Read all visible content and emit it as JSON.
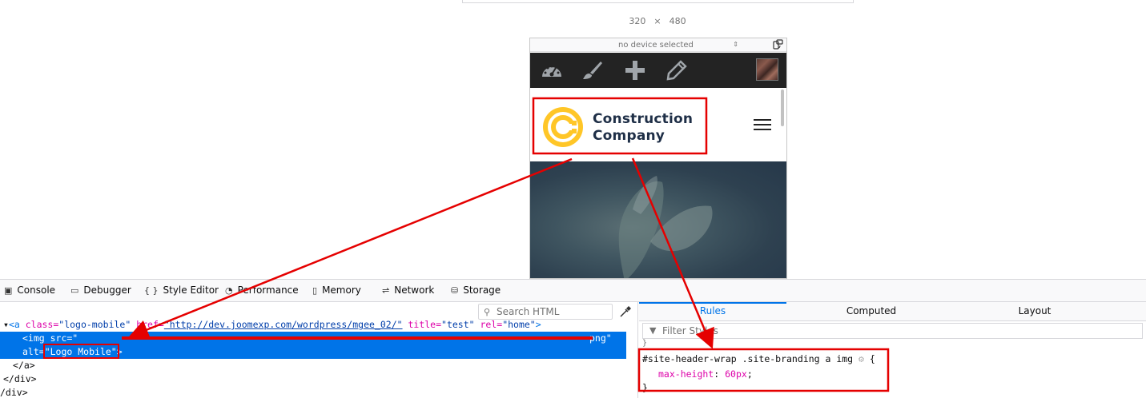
{
  "device": {
    "width": "320",
    "times": "×",
    "height": "480",
    "select_label": "no device selected",
    "select_arrows": "⇕",
    "rotate_icon": "rotate-icon"
  },
  "wp_admin_bar": {
    "icons": [
      "dashboard-icon",
      "customize-brush-icon",
      "new-plus-icon",
      "edit-pencil-icon"
    ],
    "avatar": "user-avatar"
  },
  "site": {
    "logo_line1": "Construction",
    "logo_line2": "Company",
    "menu_icon": "hamburger-icon",
    "logo_color": "#ffc627",
    "text_color": "#1f2f47"
  },
  "devtools": {
    "tabs": [
      {
        "icon": "▣",
        "label": "Console"
      },
      {
        "icon": "▭",
        "label": "Debugger"
      },
      {
        "icon": "{ }",
        "label": "Style Editor"
      },
      {
        "icon": "◔",
        "label": "Performance"
      },
      {
        "icon": "▯",
        "label": "Memory"
      },
      {
        "icon": "⇌",
        "label": "Network"
      },
      {
        "icon": "⛁",
        "label": "Storage"
      }
    ],
    "search_placeholder": "Search HTML",
    "markup": {
      "line1_tag_open": "<a ",
      "line1_class_attr": "class=",
      "line1_class_val": "\"logo-mobile\"",
      "line1_href_attr": " href=",
      "line1_href_val": "\"http://dev.joomexp.com/wordpress/mgee_02/\"",
      "line1_title_attr": " title=",
      "line1_title_val": "\"test\"",
      "line1_rel_attr": " rel=",
      "line1_rel_val": "\"home\"",
      "line1_close": ">",
      "line2_prefix": "<img src=\"",
      "line2_src_end": "png\"",
      "line3_alt_attr": "alt=",
      "line3_alt_val": "\"Logo Mobile\"",
      "line3_close": ">",
      "line4": "</a>",
      "line5": "</div>",
      "line6": "/div>"
    },
    "rules_tabs": [
      "Rules",
      "Computed",
      "Layout"
    ],
    "filter_placeholder": "Filter Styles",
    "rule": {
      "prev_close": "}",
      "selector": "#site-header-wrap .site-branding a img",
      "open_brace": "{",
      "property": "max-height",
      "colon": ": ",
      "value": "60px",
      "semicolon": ";",
      "close_brace": "}"
    }
  },
  "annotation_color": "#e50000"
}
